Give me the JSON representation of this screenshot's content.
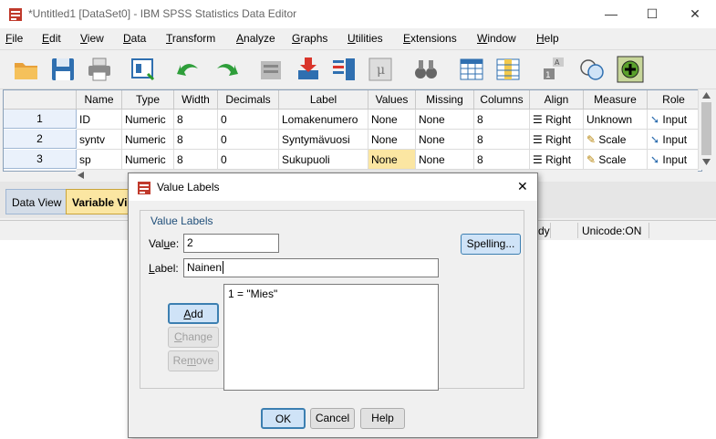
{
  "window": {
    "title": "*Untitled1 [DataSet0] - IBM SPSS Statistics Data Editor",
    "minimize": "—",
    "maximize": "☐",
    "close": "✕"
  },
  "menu": [
    {
      "first": "F",
      "rest": "ile"
    },
    {
      "first": "E",
      "rest": "dit"
    },
    {
      "first": "V",
      "rest": "iew"
    },
    {
      "first": "D",
      "rest": "ata"
    },
    {
      "first": "T",
      "rest": "ransform"
    },
    {
      "first": "A",
      "rest": "nalyze"
    },
    {
      "first": "G",
      "rest": "raphs"
    },
    {
      "first": "U",
      "rest": "tilities"
    },
    {
      "first": "E",
      "rest": "xtensions"
    },
    {
      "first": "W",
      "rest": "indow"
    },
    {
      "first": "H",
      "rest": "elp"
    }
  ],
  "grid": {
    "headers": [
      "Name",
      "Type",
      "Width",
      "Decimals",
      "Label",
      "Values",
      "Missing",
      "Columns",
      "Align",
      "Measure",
      "Role"
    ],
    "rows": [
      {
        "num": "1",
        "name": "ID",
        "type": "Numeric",
        "width": "8",
        "decimals": "0",
        "label": "Lomakenumero",
        "values": "None",
        "missing": "None",
        "columns": "8",
        "align": "Right",
        "measure": "Unknown",
        "role": "Input"
      },
      {
        "num": "2",
        "name": "syntv",
        "type": "Numeric",
        "width": "8",
        "decimals": "0",
        "label": "Syntymävuosi",
        "values": "None",
        "missing": "None",
        "columns": "8",
        "align": "Right",
        "measure": "Scale",
        "role": "Input"
      },
      {
        "num": "3",
        "name": "sp",
        "type": "Numeric",
        "width": "8",
        "decimals": "0",
        "label": "Sukupuoli",
        "values": "None",
        "missing": "None",
        "columns": "8",
        "align": "Right",
        "measure": "Scale",
        "role": "Input"
      }
    ]
  },
  "tabs": {
    "data_view": "Data View",
    "variable_view": "Variable View"
  },
  "status": {
    "ready": "dy",
    "unicode": "Unicode:ON"
  },
  "dialog": {
    "title": "Value Labels",
    "group_label": "Value Labels",
    "value_label_prefix": "Val",
    "value_label_u": "u",
    "value_label_suffix": "e:",
    "label_label_prefix": "",
    "label_label_u": "L",
    "label_label_suffix": "abel:",
    "value": "2",
    "label": "Nainen",
    "list_items": [
      "1 = \"Mies\""
    ],
    "spelling": "Spelling...",
    "add_u": "A",
    "add_rest": "dd",
    "change_u": "C",
    "change_rest": "hange",
    "remove_first": "Re",
    "remove_u": "m",
    "remove_rest": "ove",
    "ok": "OK",
    "cancel": "Cancel",
    "help": "Help",
    "close": "✕"
  },
  "colors": {
    "selected_cell": "#fbe6a2",
    "accent_blue": "#3c7fb1"
  }
}
